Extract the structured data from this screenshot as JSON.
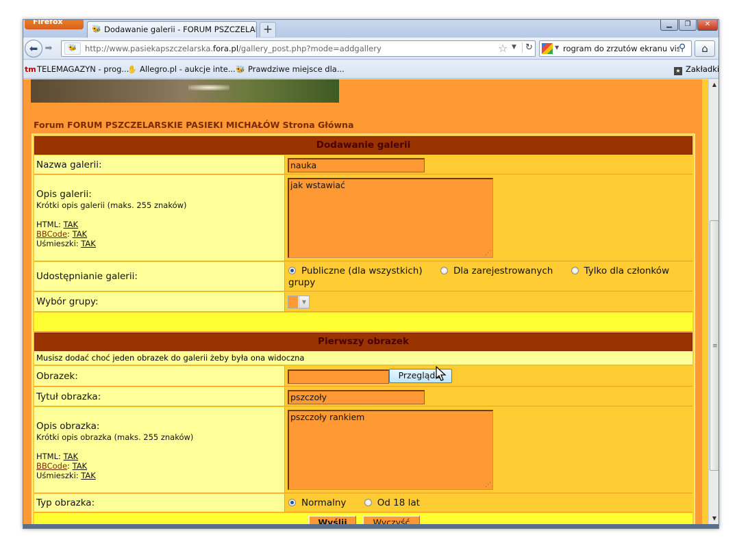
{
  "browser": {
    "app_button": "Firefox",
    "tab_title": "Dodawanie galerii - FORUM PSZCZELAR...",
    "new_tab": "+",
    "url_prefix": "http://www.pasiekapszczelarska.",
    "url_domain": "fora.pl",
    "url_suffix": "/gallery_post.php?mode=addgallery",
    "search_text": "rogram do zrzutów ekranu vista",
    "bookmarks": [
      {
        "label": "TELEMAGAZYN - prog..."
      },
      {
        "label": "Allegro.pl - aukcje inte..."
      },
      {
        "label": "Prawdziwe miejsce dla..."
      }
    ],
    "bookmarks_folder": "Zakładki"
  },
  "page": {
    "forum_nav": "Forum FORUM PSZCZELARSKIE PASIEKI MICHAŁÓW Strona Główna",
    "gallery_section": {
      "header": "Dodawanie galerii",
      "name_label": "Nazwa galerii:",
      "name_value": "nauka",
      "desc_label": "Opis galerii:",
      "desc_hint": "Krótki opis galerii (maks. 255 znaków)",
      "html_label": "HTML:",
      "html_value": "TAK",
      "bbcode_label": "BBCode",
      "bbcode_value": "TAK",
      "smilies_label": "Uśmieszki:",
      "smilies_value": "TAK",
      "desc_value": "jak wstawiać",
      "share_label": "Udostępnianie galerii:",
      "share_options": [
        "Publiczne (dla wszystkich)",
        "Dla zarejestrowanych",
        "Tylko dla członków"
      ],
      "share_options_wrap": "grupy",
      "share_selected": "Publiczne (dla wszystkich)",
      "group_label": "Wybór grupy:"
    },
    "image_section": {
      "header": "Pierwszy obrazek",
      "notice": "Musisz dodać choć jeden obrazek do galerii żeby była ona widoczna",
      "image_label": "Obrazek:",
      "browse_button": "Przeglądaj",
      "title_label": "Tytuł obrazka:",
      "title_value": "pszczoły",
      "desc_label": "Opis obrazka:",
      "desc_hint": "Krótki opis obrazka (maks. 255 znaków)",
      "html_label": "HTML:",
      "html_value": "TAK",
      "bbcode_label": "BBCode",
      "bbcode_value": "TAK",
      "smilies_label": "Uśmieszki:",
      "smilies_value": "TAK",
      "desc_value": "pszczoły rankiem",
      "type_label": "Typ obrazka:",
      "type_options": [
        "Normalny",
        "Od 18 lat"
      ],
      "type_selected": "Normalny"
    },
    "submit_button": "Wyślij",
    "reset_button": "Wyczyść"
  },
  "colors": {
    "page_bg": "#ff9933",
    "header_bg": "#993300",
    "label_bg": "#ffff99",
    "value_bg": "#ffcc33",
    "spacer_bg": "#ffff33"
  }
}
